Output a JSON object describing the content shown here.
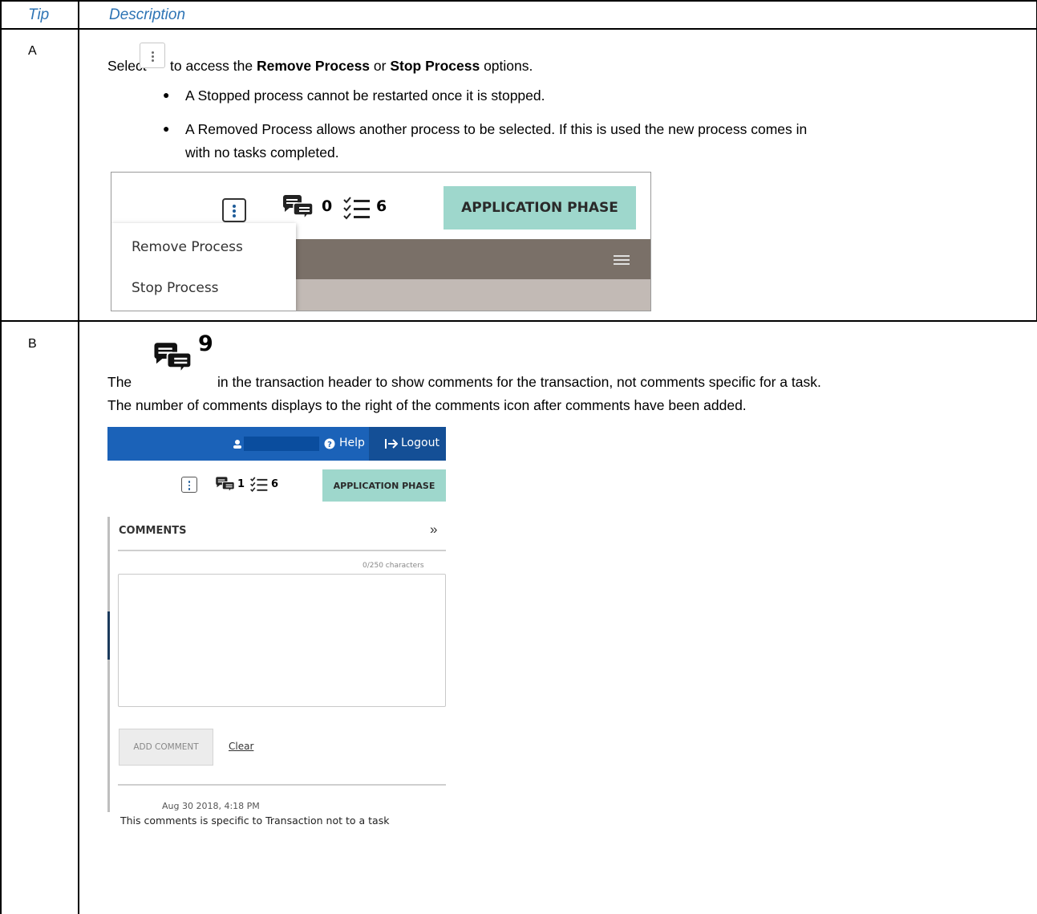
{
  "table": {
    "headers": {
      "tip": "Tip",
      "description": "Description"
    }
  },
  "rowA": {
    "letter": "A",
    "select_word": "Select",
    "sentence_middle": " to access the ",
    "remove_bold": "Remove Process",
    "or_word": " or ",
    "stop_bold": "Stop Process",
    "sentence_end": " options.",
    "bullet1": "A Stopped process cannot be restarted once it is stopped.",
    "bullet2_line1": "A Removed Process allows another process to be selected. If this is used the new process comes in",
    "bullet2_line2": "with no tasks completed.",
    "screenshot": {
      "comment_count": "0",
      "task_count": "6",
      "phase_button": "APPLICATION PHASE",
      "menu_remove": "Remove Process",
      "menu_stop": "Stop Process"
    }
  },
  "rowB": {
    "letter": "B",
    "icon_number": "9",
    "line1_start": "The",
    "line1_rest": "in the transaction header to show comments for the transaction, not comments specific for a task.",
    "line2": "The number of comments displays to the right of the comments icon after comments have been added.",
    "screenshot": {
      "help": "Help",
      "logout": "Logout",
      "comment_count": "1",
      "task_count": "6",
      "phase_button": "APPLICATION PHASE",
      "comments_title": "COMMENTS",
      "collapse_glyph": "»",
      "char_counter": "0/250 characters",
      "add_comment": "ADD COMMENT",
      "clear": "Clear",
      "comment_date": "Aug 30 2018, 4:18 PM",
      "comment_text": "This comments is specific to Transaction not to a task"
    }
  }
}
